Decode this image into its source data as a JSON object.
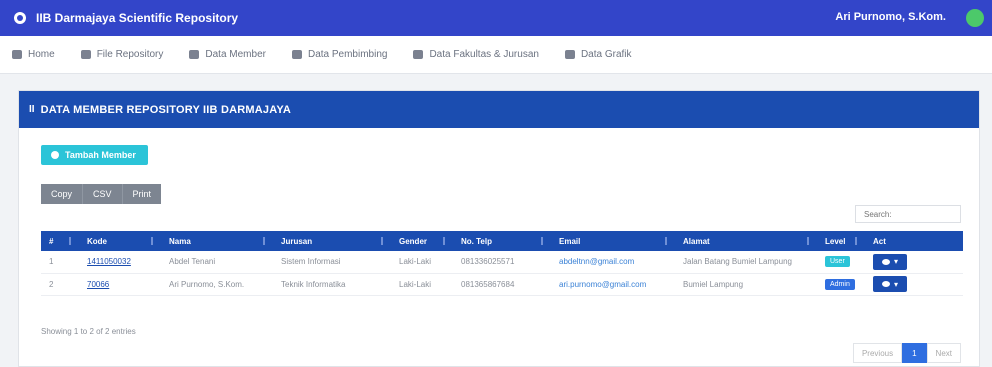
{
  "topbar": {
    "brand_title": "IIB Darmajaya Scientific Repository",
    "user_name": "Ari Purnomo, S.Kom."
  },
  "nav": {
    "items": [
      {
        "label": "Home",
        "icon": "home-icon"
      },
      {
        "label": "File Repository",
        "icon": "book-icon"
      },
      {
        "label": "Data Member",
        "icon": "user-icon"
      },
      {
        "label": "Data Pembimbing",
        "icon": "user-tie-icon"
      },
      {
        "label": "Data Fakultas & Jurusan",
        "icon": "sitemap-icon"
      },
      {
        "label": "Data Grafik",
        "icon": "chart-icon"
      }
    ]
  },
  "panel": {
    "header_icon": "II",
    "title": "DATA MEMBER REPOSITORY IIB DARMAJAYA"
  },
  "actions": {
    "add_member_label": "Tambah Member"
  },
  "export": {
    "copy_label": "Copy",
    "csv_label": "CSV",
    "print_label": "Print"
  },
  "search": {
    "placeholder": "Search:"
  },
  "table": {
    "columns": [
      "#",
      "Kode",
      "Nama",
      "Jurusan",
      "Gender",
      "No. Telp",
      "Email",
      "Alamat",
      "Level",
      "Act"
    ],
    "rows": [
      {
        "no": "1",
        "kode": "1411050032",
        "nama": "Abdel Tenani",
        "jurusan": "Sistem Informasi",
        "gender": "Laki-Laki",
        "telp": "081336025571",
        "email": "abdeltnn@gmail.com",
        "alamat": "Jalan Batang Bumiel Lampung",
        "level": "User",
        "level_color": "#2bc4d8"
      },
      {
        "no": "2",
        "kode": "70066",
        "nama": "Ari Purnomo, S.Kom.",
        "jurusan": "Teknik Informatika",
        "gender": "Laki-Laki",
        "telp": "081365867684",
        "email": "ari.purnomo@gmail.com",
        "alamat": "Bumiel Lampung",
        "level": "Admin",
        "level_color": "#2f6ee0"
      }
    ]
  },
  "info": {
    "showing_text": "Showing 1 to 2 of 2 entries"
  },
  "pagination": {
    "previous_label": "Previous",
    "current_page": "1",
    "next_label": "Next"
  },
  "colors": {
    "topbar": "#3345c9",
    "primary": "#1b4db0",
    "accent": "#2bc4d8",
    "avatar": "#4cc96a"
  }
}
